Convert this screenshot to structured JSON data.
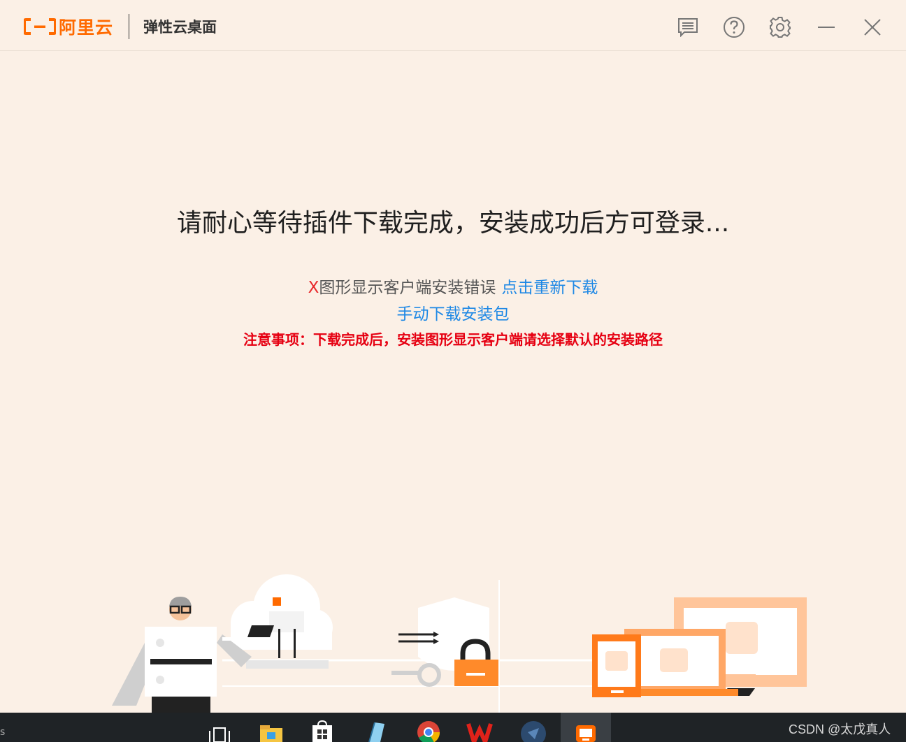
{
  "brand": {
    "name": "阿里云",
    "product": "弹性云桌面"
  },
  "toolbar": {
    "message_icon": "message-icon",
    "help_icon": "help-icon",
    "settings_icon": "gear-icon",
    "minimize_icon": "minimize-icon",
    "close_icon": "close-icon"
  },
  "main": {
    "headline": "请耐心等待插件下载完成，安装成功后方可登录...",
    "error_mark": "X",
    "error_text": "图形显示客户端安装错误",
    "retry_link": "点击重新下载",
    "manual_link": "手动下载安装包",
    "notice": "注意事项：下载完成后，安装图形显示客户端请选择默认的安装路径"
  },
  "colors": {
    "accent": "#ff6a00",
    "link": "#1e88e5",
    "error": "#e60012",
    "background": "#fbf0e6"
  },
  "taskbar": {
    "items": [
      "task-view-icon",
      "file-explorer-icon",
      "store-icon",
      "notepad-icon",
      "chrome-icon",
      "wps-icon",
      "feishu-icon",
      "cloud-desktop-icon"
    ],
    "edge_char": "s",
    "watermark": "CSDN @太戊真人"
  }
}
